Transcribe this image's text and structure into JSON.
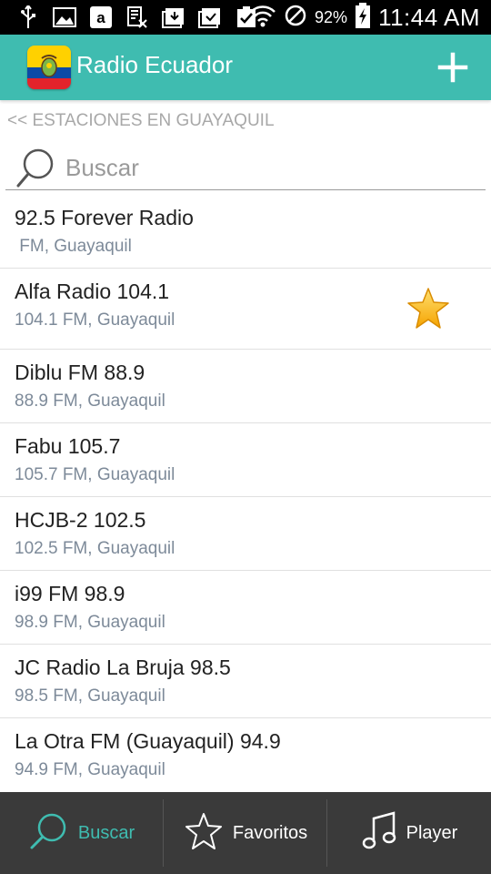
{
  "status_bar": {
    "battery": "92%",
    "time": "11:44 AM"
  },
  "app": {
    "title": "Radio Ecuador"
  },
  "breadcrumb": "<< ESTACIONES EN GUAYAQUIL",
  "search": {
    "placeholder": "Buscar"
  },
  "stations": [
    {
      "name": "92.5 Forever Radio",
      "sub": " FM, Guayaquil",
      "favorite": false
    },
    {
      "name": "Alfa Radio 104.1",
      "sub": "104.1 FM, Guayaquil",
      "favorite": true
    },
    {
      "name": "Diblu FM 88.9",
      "sub": "88.9 FM, Guayaquil",
      "favorite": false
    },
    {
      "name": "Fabu 105.7",
      "sub": "105.7 FM, Guayaquil",
      "favorite": false
    },
    {
      "name": "HCJB-2 102.5",
      "sub": "102.5 FM, Guayaquil",
      "favorite": false
    },
    {
      "name": "i99 FM 98.9",
      "sub": "98.9 FM, Guayaquil",
      "favorite": false
    },
    {
      "name": "JC Radio La Bruja 98.5",
      "sub": "98.5 FM, Guayaquil",
      "favorite": false
    },
    {
      "name": "La Otra FM (Guayaquil) 94.9",
      "sub": "94.9 FM, Guayaquil",
      "favorite": false
    }
  ],
  "bottom_nav": [
    {
      "label": "Buscar",
      "icon": "search-icon",
      "active": true
    },
    {
      "label": "Favoritos",
      "icon": "star-outline-icon",
      "active": false
    },
    {
      "label": "Player",
      "icon": "music-note-icon",
      "active": false
    }
  ],
  "colors": {
    "accent": "#3fbcb0",
    "bottom_bar": "#3a3a3a"
  }
}
